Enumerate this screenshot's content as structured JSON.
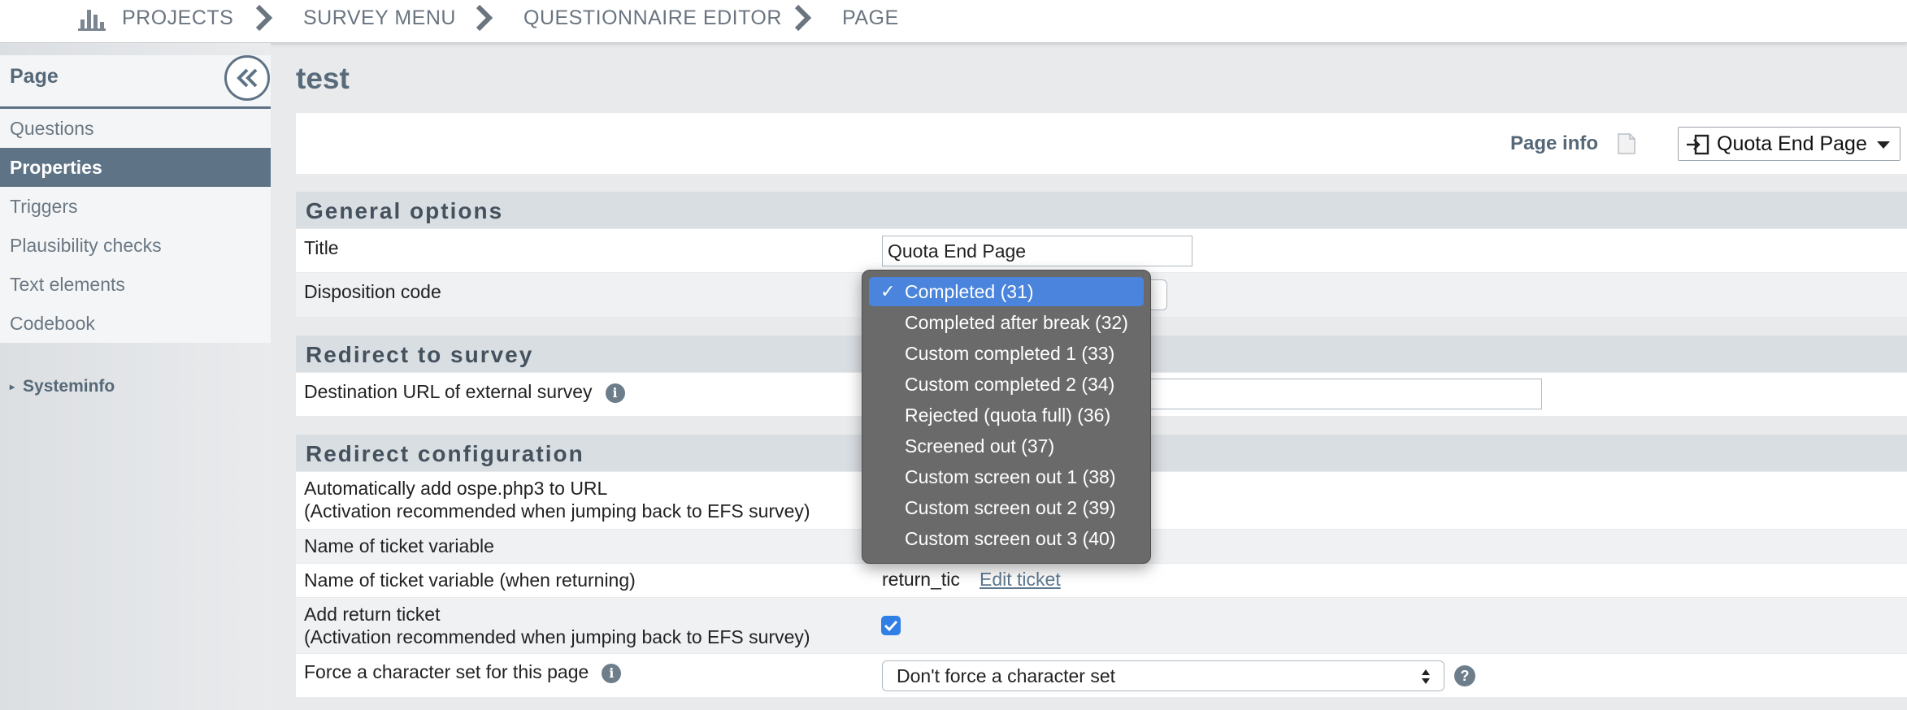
{
  "breadcrumb": {
    "items": [
      "PROJECTS",
      "SURVEY MENU",
      "QUESTIONNAIRE EDITOR",
      "PAGE"
    ],
    "icon": "bar-chart-icon"
  },
  "sidebar": {
    "title": "Page",
    "items": [
      {
        "label": "Questions",
        "active": false
      },
      {
        "label": "Properties",
        "active": true
      },
      {
        "label": "Triggers",
        "active": false
      },
      {
        "label": "Plausibility checks",
        "active": false
      },
      {
        "label": "Text elements",
        "active": false
      },
      {
        "label": "Codebook",
        "active": false
      }
    ],
    "systeminfo": "Systeminfo"
  },
  "main": {
    "title": "test",
    "page_info_label": "Page info",
    "page_type_button": "Quota End Page"
  },
  "general_options": {
    "heading": "General options",
    "title_label": "Title",
    "title_value": "Quota End Page",
    "disposition_label": "Disposition code"
  },
  "redirect_survey": {
    "heading": "Redirect to survey",
    "dest_url_label": "Destination URL of external survey",
    "dest_url_value": ""
  },
  "redirect_config": {
    "heading": "Redirect configuration",
    "auto_add_label_1": "Automatically add ospe.php3 to URL",
    "auto_add_label_2": "(Activation recommended when jumping back to EFS survey)",
    "ticket_var_label": "Name of ticket variable",
    "ticket_var_return_label": "Name of ticket variable (when returning)",
    "ticket_var_return_value": "return_tic",
    "edit_ticket": "Edit ticket",
    "add_return_label_1": "Add return ticket",
    "add_return_label_2": "(Activation recommended when jumping back to EFS survey)",
    "add_return_checked": true,
    "charset_label": "Force a character set for this page",
    "charset_value": "Don't force a character set"
  },
  "disposition_dropdown": {
    "selected_index": 0,
    "options": [
      "Completed (31)",
      "Completed after break (32)",
      "Custom completed 1 (33)",
      "Custom completed 2 (34)",
      "Rejected (quota full) (36)",
      "Screened out (37)",
      "Custom screen out 1 (38)",
      "Custom screen out 2 (39)",
      "Custom screen out 3 (40)"
    ]
  },
  "colors": {
    "accent": "#5e7385",
    "selection": "#4a84dc",
    "checkbox": "#2f7fe6"
  }
}
